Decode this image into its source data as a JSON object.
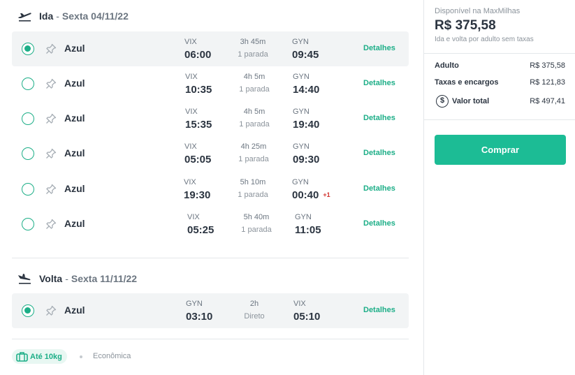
{
  "outbound": {
    "direction": "Ida",
    "separator": "-",
    "date": "Sexta 04/11/22",
    "flights": [
      {
        "airline": "Azul",
        "orig": "VIX",
        "dep": "06:00",
        "duration": "3h 45m",
        "stops": "1 parada",
        "dest": "GYN",
        "arr": "09:45",
        "plus": "",
        "details": "Detalhes",
        "selected": true
      },
      {
        "airline": "Azul",
        "orig": "VIX",
        "dep": "10:35",
        "duration": "4h 5m",
        "stops": "1 parada",
        "dest": "GYN",
        "arr": "14:40",
        "plus": "",
        "details": "Detalhes",
        "selected": false
      },
      {
        "airline": "Azul",
        "orig": "VIX",
        "dep": "15:35",
        "duration": "4h 5m",
        "stops": "1 parada",
        "dest": "GYN",
        "arr": "19:40",
        "plus": "",
        "details": "Detalhes",
        "selected": false
      },
      {
        "airline": "Azul",
        "orig": "VIX",
        "dep": "05:05",
        "duration": "4h 25m",
        "stops": "1 parada",
        "dest": "GYN",
        "arr": "09:30",
        "plus": "",
        "details": "Detalhes",
        "selected": false
      },
      {
        "airline": "Azul",
        "orig": "VIX",
        "dep": "19:30",
        "duration": "5h 10m",
        "stops": "1 parada",
        "dest": "GYN",
        "arr": "00:40",
        "plus": "+1",
        "details": "Detalhes",
        "selected": false
      },
      {
        "airline": "Azul",
        "orig": "VIX",
        "dep": "05:25",
        "duration": "5h 40m",
        "stops": "1 parada",
        "dest": "GYN",
        "arr": "11:05",
        "plus": "",
        "details": "Detalhes",
        "selected": false
      }
    ]
  },
  "return": {
    "direction": "Volta",
    "separator": "-",
    "date": "Sexta 11/11/22",
    "flights": [
      {
        "airline": "Azul",
        "orig": "GYN",
        "dep": "03:10",
        "duration": "2h",
        "stops": "Direto",
        "dest": "VIX",
        "arr": "05:10",
        "plus": "",
        "details": "Detalhes",
        "selected": true
      }
    ]
  },
  "footer": {
    "baggage": "Até 10kg",
    "cabin": "Econômica"
  },
  "summary": {
    "available_text": "Disponível na MaxMilhas",
    "price": "R$ 375,58",
    "price_note": "Ida e volta por adulto sem taxas",
    "adult_label": "Adulto",
    "adult_value": "R$ 375,58",
    "taxes_label": "Taxas e encargos",
    "taxes_value": "R$ 121,83",
    "total_icon": "$",
    "total_label": "Valor total",
    "total_value": "R$ 497,41",
    "buy_label": "Comprar"
  },
  "colors": {
    "accent": "#1cae87",
    "button": "#1cbc95",
    "overnight": "#d0312d"
  },
  "icons": [
    "takeoff-icon",
    "landing-icon",
    "pin-icon",
    "suitcase-icon",
    "dollar-icon"
  ]
}
